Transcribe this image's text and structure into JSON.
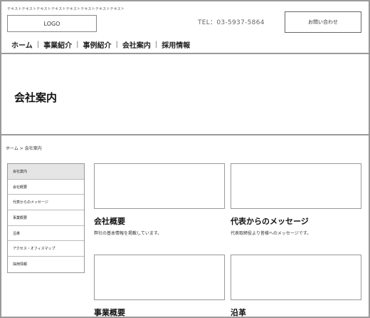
{
  "header": {
    "tagline": "テキストテキストテキストテキストテキストテキストテキストテキスト",
    "logo": "LOGO",
    "tel": "TEL：03-5937-5864",
    "contact_button": "お問い合わせ"
  },
  "nav": {
    "items": [
      "ホーム",
      "事業紹介",
      "事例紹介",
      "会社案内",
      "採用情報"
    ],
    "separator": "|"
  },
  "page": {
    "title": "会社案内"
  },
  "breadcrumb": {
    "home": "ホーム",
    "separator": ">",
    "current": "会社案内"
  },
  "sidebar": {
    "items": [
      {
        "label": "会社案内",
        "active": true
      },
      {
        "label": "会社概要",
        "active": false
      },
      {
        "label": "代表からのメッセージ",
        "active": false
      },
      {
        "label": "事業概要",
        "active": false
      },
      {
        "label": "沿革",
        "active": false
      },
      {
        "label": "アクセス・オフィスマップ",
        "active": false
      },
      {
        "label": "採用情報",
        "active": false
      }
    ]
  },
  "cards": [
    {
      "title": "会社概要",
      "desc": "弊社の基本情報を掲載しています。"
    },
    {
      "title": "代表からのメッセージ",
      "desc": "代表取締役より皆様へのメッセージです。"
    },
    {
      "title": "事業概要",
      "desc": ""
    },
    {
      "title": "沿革",
      "desc": ""
    }
  ],
  "colors": {
    "border": "#9a9a9a",
    "active_item": "#e5e5e5"
  }
}
